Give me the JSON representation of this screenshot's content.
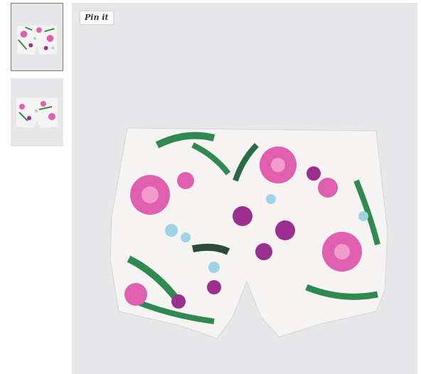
{
  "gallery": {
    "thumbnails": [
      {
        "icon": "floral-shorts-front-thumbnail",
        "selected": true
      },
      {
        "icon": "floral-shorts-back-thumbnail",
        "selected": false
      }
    ],
    "main_image": {
      "icon": "floral-shorts-photo"
    },
    "pin_button": {
      "label": "Pin it"
    }
  },
  "colors": {
    "background": "#e7e6e9",
    "fabric": "#f6f4f3",
    "pink": "#e05fae",
    "magenta": "#9b2f8f",
    "leaf_green": "#2f8a4f",
    "light_blue": "#9fd3e2"
  }
}
